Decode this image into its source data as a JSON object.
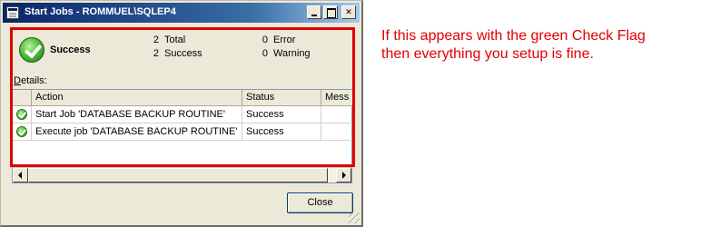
{
  "window": {
    "title": "Start Jobs - ROMMUEL\\SQLEP4"
  },
  "summary": {
    "status": "Success",
    "total_count": "2",
    "total_label": "Total",
    "success_count": "2",
    "success_label": "Success",
    "error_count": "0",
    "error_label": "Error",
    "warning_count": "0",
    "warning_label": "Warning"
  },
  "details": {
    "label_underlined": "D",
    "label_rest": "etails:",
    "columns": [
      "Action",
      "Status",
      "Mess"
    ],
    "rows": [
      {
        "action": "Start Job 'DATABASE BACKUP ROUTINE'",
        "status": "Success",
        "message": ""
      },
      {
        "action": "Execute job 'DATABASE BACKUP ROUTINE'",
        "status": "Success",
        "message": ""
      }
    ]
  },
  "buttons": {
    "close": "Close"
  },
  "annotation": {
    "line1": "If this appears with the green Check Flag",
    "line2": "then everything you setup is fine."
  },
  "colors": {
    "annotation": "#e00000",
    "highlight_border": "#e00000",
    "title_bar": "#0a246a",
    "success_icon": "#4fbf3c"
  },
  "icons": {
    "app": "dialog-app-icon",
    "status": "success-check-icon",
    "row_status": "success-check-icon"
  }
}
